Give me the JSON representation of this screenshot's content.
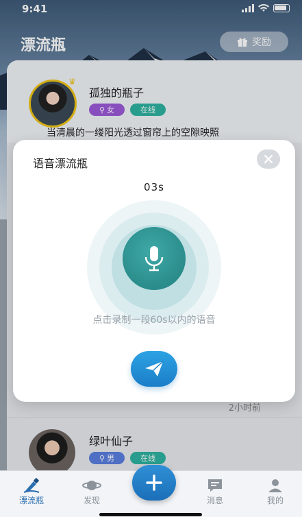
{
  "status_bar": {
    "time": "9:41"
  },
  "header": {
    "title": "漂流瓶",
    "reward_label": "奖励"
  },
  "bottles": [
    {
      "name": "孤独的瓶子",
      "gender": "女",
      "online": "在线",
      "snippet": "当清晨的一缕阳光透过窗帘上的空隙映照"
    },
    {
      "time_ago": "2小时前"
    },
    {
      "name": "绿叶仙子",
      "gender": "男",
      "online": "在线"
    }
  ],
  "modal": {
    "title": "语音漂流瓶",
    "timer": "03s",
    "hint": "点击录制一段60s以内的语音"
  },
  "tabbar": {
    "items": [
      {
        "label": "漂流瓶",
        "icon": "bottle-icon"
      },
      {
        "label": "发现",
        "icon": "planet-icon"
      },
      {
        "label": "消息",
        "icon": "message-icon"
      },
      {
        "label": "我的",
        "icon": "profile-icon"
      }
    ],
    "active_index": 0
  },
  "colors": {
    "accent": "#1b7ec8",
    "mic": "#21807f",
    "online": "#2fb3a1",
    "female": "#9b59d8",
    "male": "#5b7fe0"
  }
}
